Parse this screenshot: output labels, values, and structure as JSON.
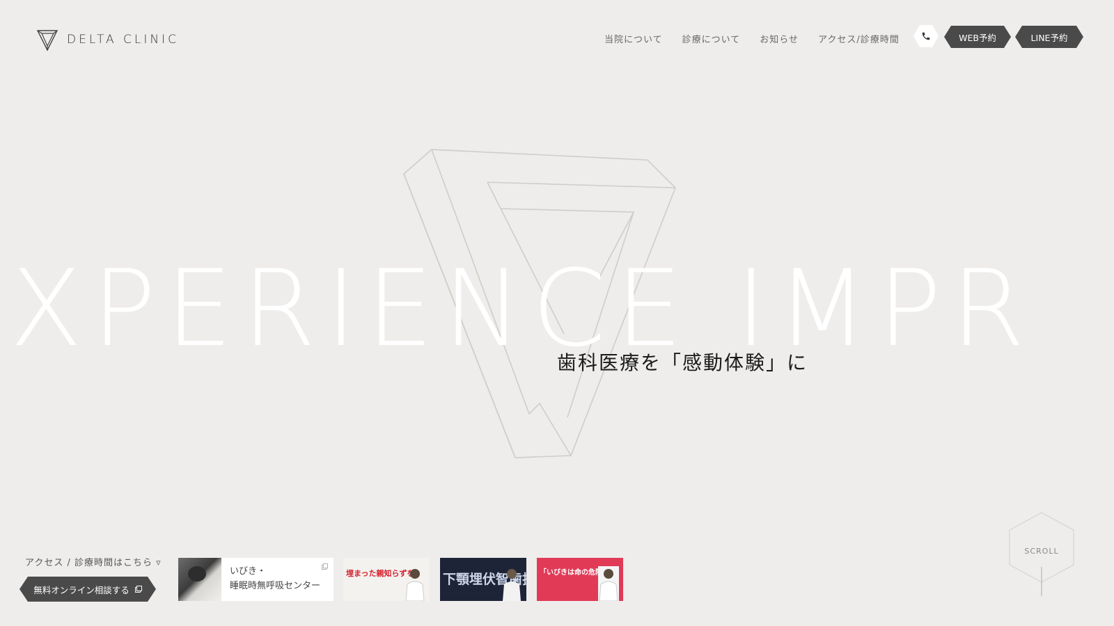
{
  "brand": {
    "name": "DELTA CLINIC"
  },
  "nav": {
    "items": [
      "当院について",
      "診療について",
      "お知らせ",
      "アクセス/診療時間"
    ],
    "web_reserve": "WEB予約",
    "line_reserve": "LINE予約"
  },
  "hero": {
    "big_text": "XPERIENCE IMPR",
    "tagline": "歯科医療を「感動体験」に"
  },
  "bottom": {
    "access_link": "アクセス / 診療時間はこちら ▿",
    "consult_button": "無料オンライン相談する"
  },
  "banners": {
    "main_line1": "いびき・",
    "main_line2": "睡眠時無呼吸センター",
    "thumb1_title": "埋まった親知らずを",
    "thumb2_title": "下顎埋伏智歯抜歯",
    "thumb3_title": "「いびきは命の危険に"
  },
  "scroll": {
    "label": "SCROLL"
  },
  "colors": {
    "background": "#eeedeb",
    "button": "#4a4a4a",
    "accent_red": "#e03a57"
  }
}
